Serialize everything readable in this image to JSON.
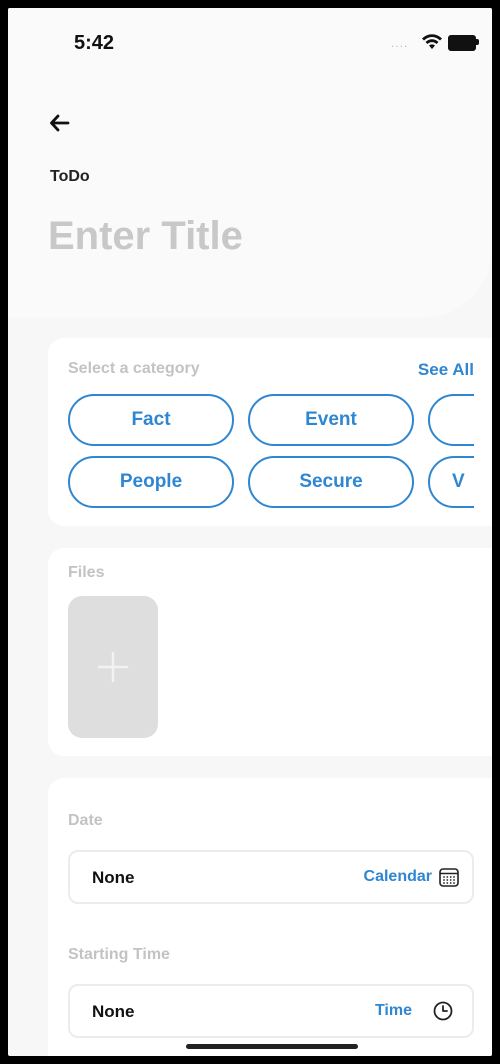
{
  "status_bar": {
    "time": "5:42",
    "signal": "....",
    "wifi_icon": "wifi-icon",
    "battery_icon": "battery-icon"
  },
  "header": {
    "back_icon": "arrow-left-icon",
    "type_label": "ToDo",
    "title_placeholder": "Enter Title",
    "title_value": ""
  },
  "category": {
    "label": "Select a category",
    "see_all": "See All",
    "chips": [
      "Fact",
      "Event",
      "",
      "People",
      "Secure",
      "V"
    ]
  },
  "files": {
    "label": "Files",
    "add_icon": "plus-icon"
  },
  "date": {
    "label": "Date",
    "value": "None",
    "action": "Calendar",
    "action_icon": "calendar-icon"
  },
  "starting_time": {
    "label": "Starting Time",
    "value": "None",
    "action": "Time",
    "action_icon": "clock-icon"
  },
  "colors": {
    "accent": "#2f86d1",
    "muted_label": "#c3c3c3",
    "placeholder": "#c8c8c8",
    "file_tile": "#dedede"
  }
}
